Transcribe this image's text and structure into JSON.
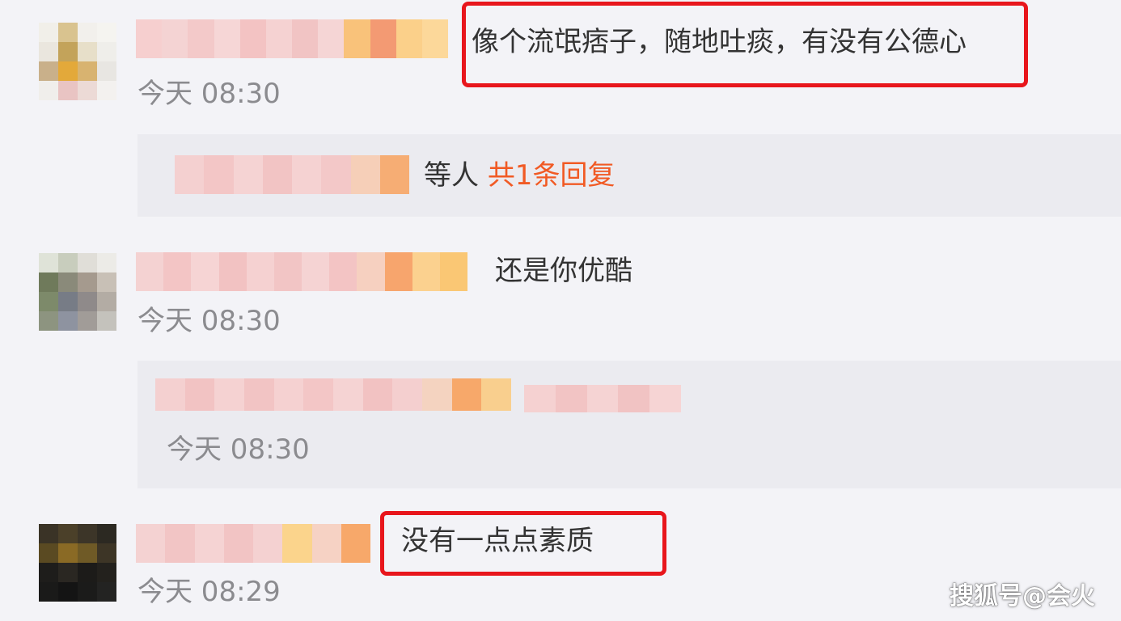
{
  "comments": [
    {
      "text": "像个流氓痞子，随地吐痰，有没有公德心",
      "time": "今天 08:30"
    },
    {
      "text": "还是你优酷",
      "time": "今天 08:30"
    },
    {
      "text": "没有一点点素质",
      "time": "今天 08:29"
    }
  ],
  "reply_preview": {
    "suffix": "等人",
    "count_link": "共1条回复"
  },
  "nested_reply": {
    "time": "今天 08:30"
  },
  "watermark": "搜狐号@会火",
  "colors": {
    "highlight_border": "#e8161c",
    "reply_link": "#f15a24",
    "timestamp": "#8b8b8f"
  }
}
